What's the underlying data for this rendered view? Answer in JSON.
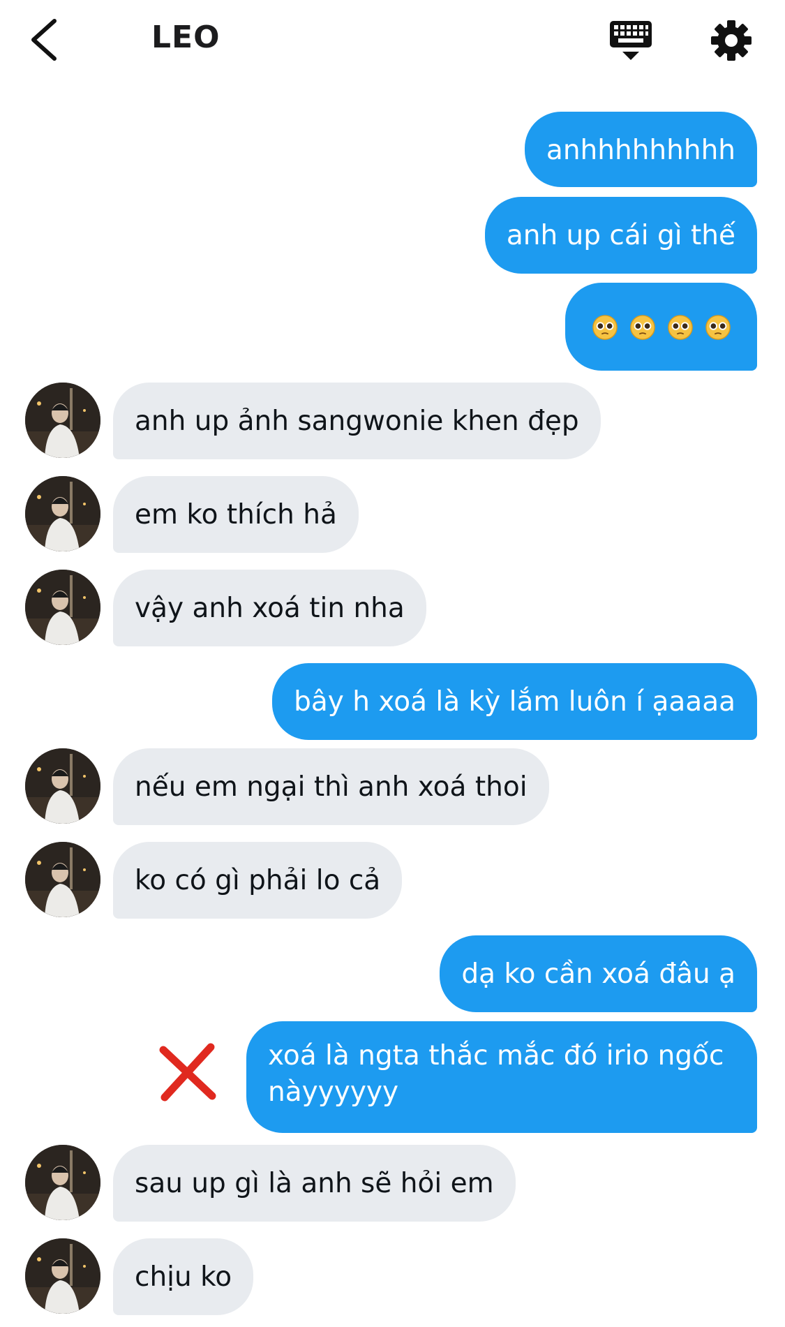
{
  "header": {
    "title": "LEO",
    "icons": {
      "back": "chevron-left-icon",
      "keyboard": "keyboard-icon",
      "settings": "gear-icon"
    }
  },
  "messages": [
    {
      "side": "out",
      "text": "anhhhhhhhhh"
    },
    {
      "side": "out",
      "text": "anh up cái gì thế"
    },
    {
      "side": "out",
      "text": "",
      "emoji": [
        "pleading-face",
        "pleading-face",
        "pleading-face",
        "pleading-face"
      ]
    },
    {
      "side": "in",
      "text": "anh up ảnh sangwonie khen đẹp"
    },
    {
      "side": "in",
      "text": "em ko thích hả"
    },
    {
      "side": "in",
      "text": "vậy anh xoá tin nha"
    },
    {
      "side": "out",
      "text": "bây h xoá là kỳ lắm luôn í ạaaaa"
    },
    {
      "side": "in",
      "text": "nếu em ngại thì anh xoá thoi"
    },
    {
      "side": "in",
      "text": "ko có gì phải lo cả"
    },
    {
      "side": "out",
      "text": "dạ ko cần xoá đâu ạ"
    },
    {
      "side": "out",
      "text": "xoá là ngta thắc mắc đó irio ngốc nàyyyyyy",
      "marked": "red-x-icon"
    },
    {
      "side": "in",
      "text": "sau up gì là anh sẽ hỏi em"
    },
    {
      "side": "in",
      "text": "chịu ko"
    }
  ],
  "colors": {
    "outgoing_bubble": "#1d9bf0",
    "incoming_bubble": "#e8ebef",
    "x_mark": "#e0291f"
  }
}
